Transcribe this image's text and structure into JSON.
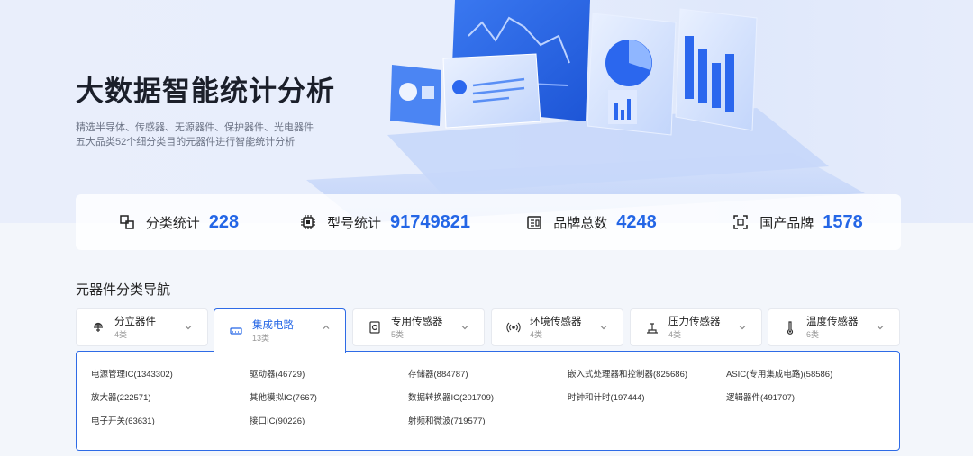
{
  "hero": {
    "title": "大数据智能统计分析",
    "desc_line1": "精选半导体、传感器、无源器件、保护器件、光电器件",
    "desc_line2": "五大品类52个细分类目的元器件进行智能统计分析"
  },
  "stats": [
    {
      "label": "分类统计",
      "value": "228",
      "icon": "category-icon"
    },
    {
      "label": "型号统计",
      "value": "91749821",
      "icon": "chip-icon"
    },
    {
      "label": "品牌总数",
      "value": "4248",
      "icon": "brand-icon"
    },
    {
      "label": "国产品牌",
      "value": "1578",
      "icon": "scan-icon"
    }
  ],
  "nav": {
    "title": "元器件分类导航",
    "tabs": [
      {
        "name": "分立器件",
        "count": "4类",
        "icon": "discrete-icon"
      },
      {
        "name": "集成电路",
        "count": "13类",
        "icon": "ic-icon"
      },
      {
        "name": "专用传感器",
        "count": "5类",
        "icon": "special-sensor-icon"
      },
      {
        "name": "环境传感器",
        "count": "4类",
        "icon": "env-sensor-icon"
      },
      {
        "name": "压力传感器",
        "count": "4类",
        "icon": "pressure-sensor-icon"
      },
      {
        "name": "温度传感器",
        "count": "6类",
        "icon": "thermometer-icon"
      }
    ],
    "subcategories": [
      "电源管理IC(1343302)",
      "驱动器(46729)",
      "存储器(884787)",
      "嵌入式处理器和控制器(825686)",
      "ASIC(专用集成电路)(58586)",
      "放大器(222571)",
      "其他模拟IC(7667)",
      "数据转换器IC(201709)",
      "时钟和计时(197444)",
      "逻辑器件(491707)",
      "电子开关(63631)",
      "接口IC(90226)",
      "射频和微波(719577)"
    ]
  },
  "colors": {
    "accent": "#2466e6",
    "border_active": "#2e6be6"
  }
}
